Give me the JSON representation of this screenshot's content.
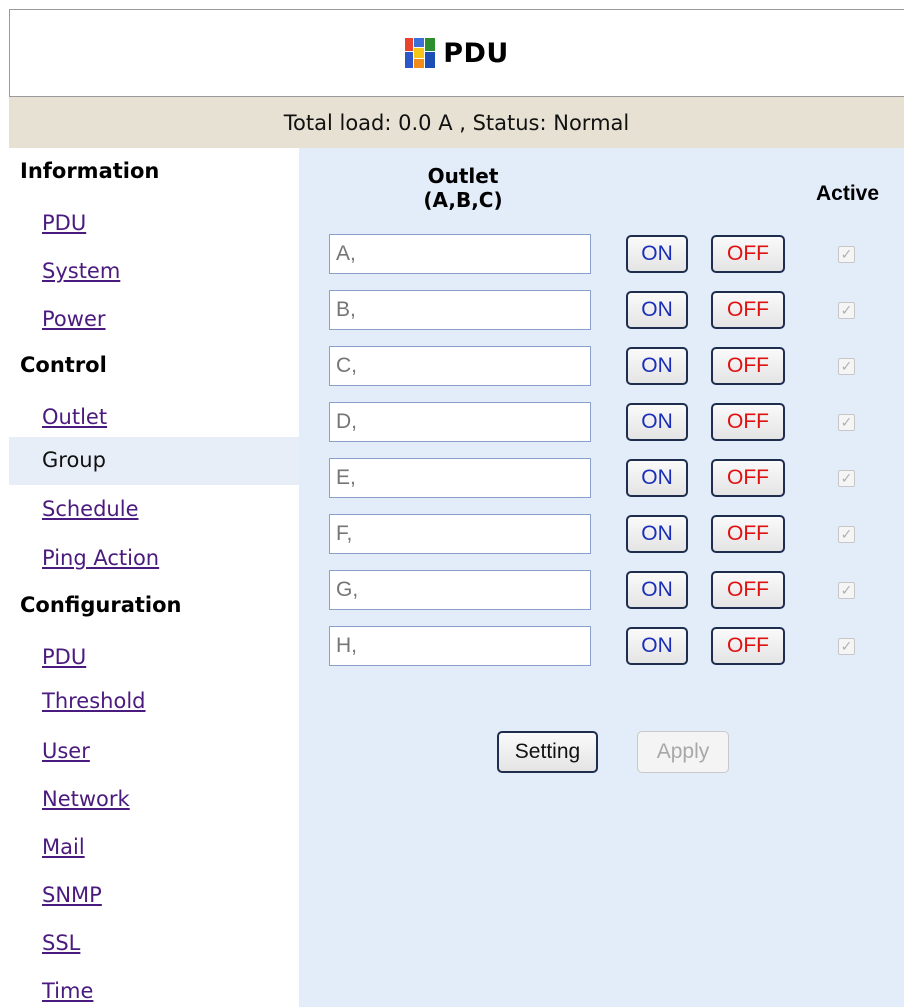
{
  "header": {
    "title": "PDU",
    "logo_icon": "windows-flag-icon"
  },
  "status": {
    "text": "Total load: 0.0 A , Status: Normal"
  },
  "sidebar": {
    "information": {
      "heading": "Information",
      "items": [
        "PDU",
        "System",
        "Power"
      ]
    },
    "control": {
      "heading": "Control",
      "items": [
        "Outlet",
        "Group",
        "Schedule",
        "Ping Action"
      ],
      "active": "Group"
    },
    "configuration": {
      "heading": "Configuration",
      "items": [
        "PDU",
        "Threshold",
        "User",
        "Network",
        "Mail",
        "SNMP",
        "SSL",
        "Time"
      ]
    }
  },
  "table": {
    "outlet_header_line1": "Outlet",
    "outlet_header_line2": "(A,B,C)",
    "active_header": "Active",
    "on_label": "ON",
    "off_label": "OFF",
    "rows": [
      {
        "placeholder": "A,",
        "active": true
      },
      {
        "placeholder": "B,",
        "active": true
      },
      {
        "placeholder": "C,",
        "active": true
      },
      {
        "placeholder": "D,",
        "active": true
      },
      {
        "placeholder": "E,",
        "active": true
      },
      {
        "placeholder": "F,",
        "active": true
      },
      {
        "placeholder": "G,",
        "active": true
      },
      {
        "placeholder": "H,",
        "active": true
      }
    ]
  },
  "actions": {
    "setting_label": "Setting",
    "apply_label": "Apply"
  },
  "colors": {
    "status_bar": "#e6e1d3",
    "main_bg": "#e3ecf9",
    "link": "#4b1a7e",
    "on_text": "#1a2fb8",
    "off_text": "#e01010"
  }
}
